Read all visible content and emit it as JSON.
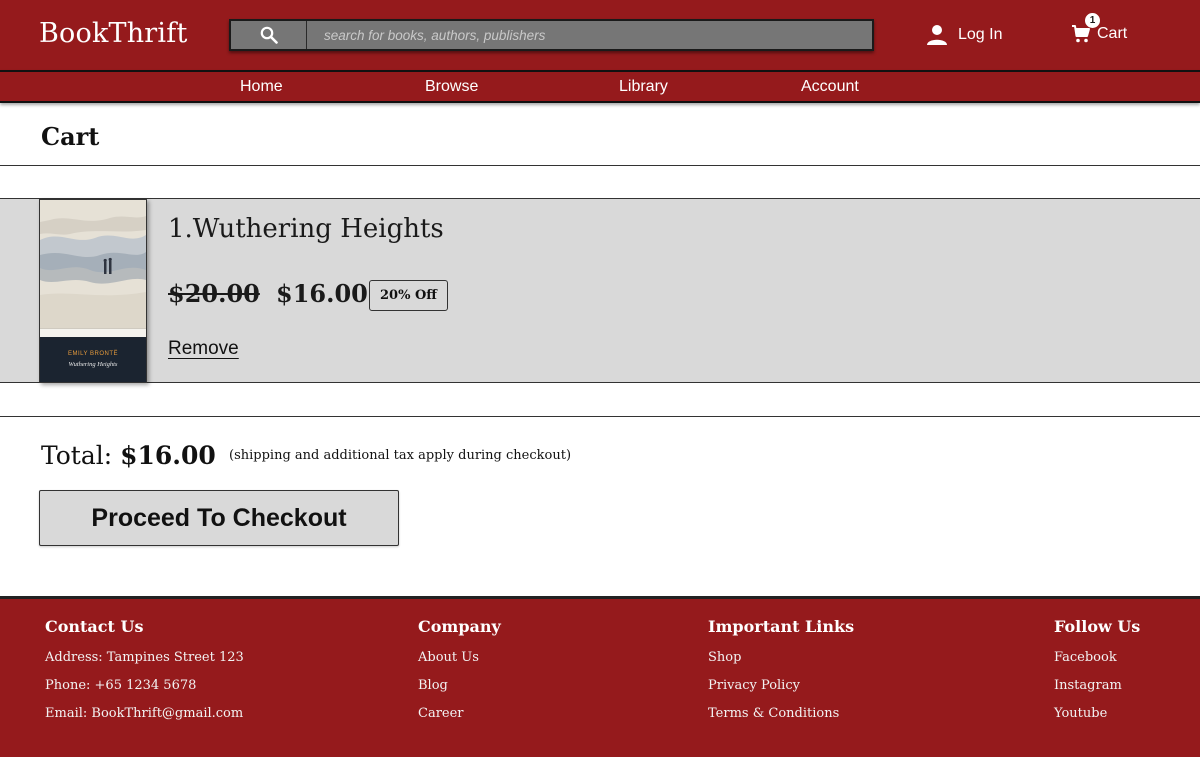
{
  "header": {
    "brand": "BookThrift",
    "search_placeholder": "search for books, authors, publishers",
    "login_label": "Log In",
    "cart_label": "Cart",
    "cart_count": "1"
  },
  "nav": {
    "items": [
      {
        "label": "Home"
      },
      {
        "label": "Browse"
      },
      {
        "label": "Library"
      },
      {
        "label": "Account"
      }
    ]
  },
  "page": {
    "title": "Cart"
  },
  "cart": {
    "items": [
      {
        "title": "1.Wuthering Heights",
        "original_price": "$20.00",
        "price": "$16.00",
        "discount": "20% Off",
        "remove_label": "Remove",
        "cover": {
          "author": "EMILY BRONTË",
          "title": "Wuthering Heights"
        }
      }
    ],
    "total_label": "Total:",
    "total_value": "$16.00",
    "total_note": "(shipping and additional tax apply during checkout)",
    "checkout_label": "Proceed To Checkout"
  },
  "footer": {
    "contact": {
      "heading": "Contact Us",
      "address": "Address: Tampines Street 123",
      "phone": "Phone: +65 1234 5678",
      "email": "Email: BookThrift@gmail.com"
    },
    "company": {
      "heading": "Company",
      "links": [
        "About Us",
        "Blog",
        "Career"
      ]
    },
    "important": {
      "heading": "Important Links",
      "links": [
        "Shop",
        "Privacy Policy",
        "Terms & Conditions"
      ]
    },
    "follow": {
      "heading": "Follow Us",
      "links": [
        "Facebook",
        "Instagram",
        "Youtube"
      ]
    }
  },
  "colors": {
    "brand_red": "#951a1c",
    "search_bg": "#767676",
    "item_bg": "#d9d9d9"
  }
}
